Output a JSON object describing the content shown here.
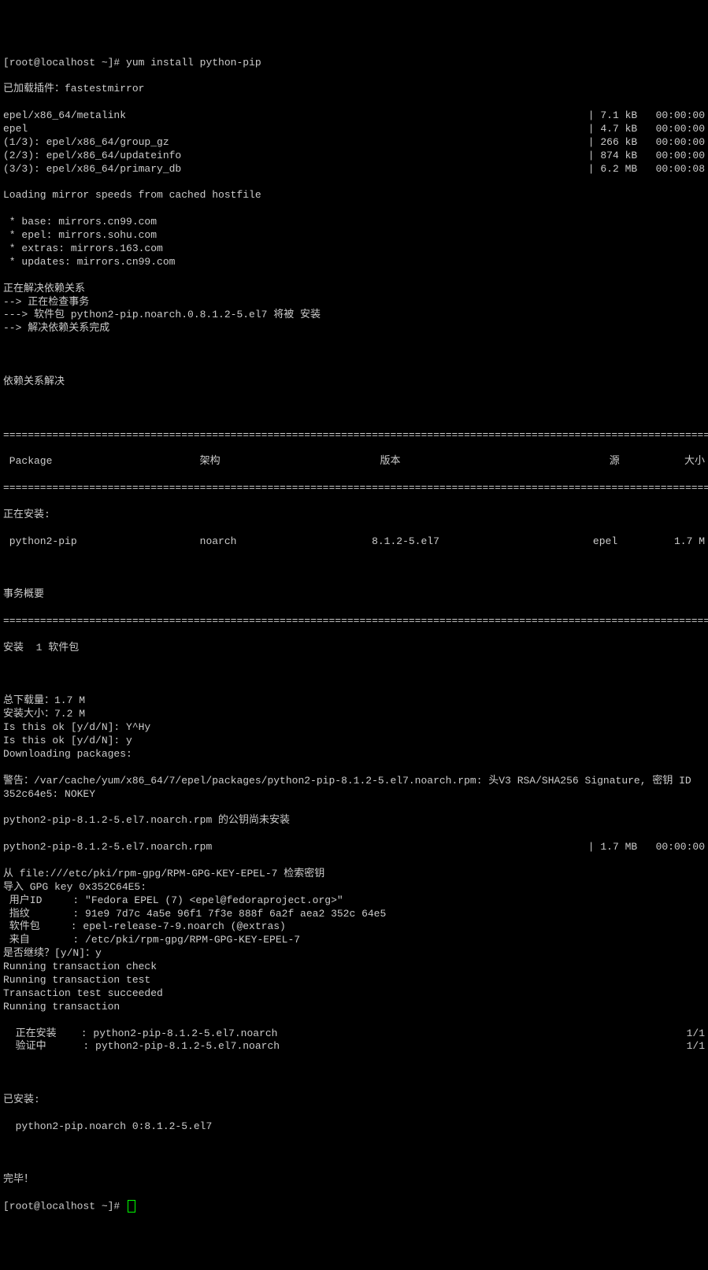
{
  "prompt1": "[root@localhost ~]# yum install python-pip",
  "plugin": "已加载插件：fastestmirror",
  "repos": [
    {
      "name": "epel/x86_64/metalink",
      "size": "7.1 kB",
      "time": "00:00:00"
    },
    {
      "name": "epel",
      "size": "4.7 kB",
      "time": "00:00:00"
    },
    {
      "name": "(1/3): epel/x86_64/group_gz",
      "size": "266 kB",
      "time": "00:00:00"
    },
    {
      "name": "(2/3): epel/x86_64/updateinfo",
      "size": "874 kB",
      "time": "00:00:00"
    },
    {
      "name": "(3/3): epel/x86_64/primary_db",
      "size": "6.2 MB",
      "time": "00:00:08"
    }
  ],
  "loading": "Loading mirror speeds from cached hostfile",
  "mirrors": [
    " * base: mirrors.cn99.com",
    " * epel: mirrors.sohu.com",
    " * extras: mirrors.163.com",
    " * updates: mirrors.cn99.com"
  ],
  "dep_lines": [
    "正在解决依赖关系",
    "--> 正在检查事务",
    "---> 软件包 python2-pip.noarch.0.8.1.2-5.el7 将被 安装",
    "--> 解决依赖关系完成"
  ],
  "dep_done": "依赖关系解决",
  "header": {
    "pkg": " Package",
    "arch": "架构",
    "ver": "版本",
    "repo": "源",
    "size": "大小"
  },
  "installing": "正在安装:",
  "row": {
    "pkg": " python2-pip",
    "arch": "noarch",
    "ver": "8.1.2-5.el7",
    "repo": "epel",
    "size": "1.7 M"
  },
  "summary": "事务概要",
  "install_count": "安装  1 软件包",
  "totals": [
    "总下载量：1.7 M",
    "安装大小：7.2 M",
    "Is this ok [y/d/N]: Y^Hy",
    "Is this ok [y/d/N]: y",
    "Downloading packages:"
  ],
  "warn": "警告：/var/cache/yum/x86_64/7/epel/packages/python2-pip-8.1.2-5.el7.noarch.rpm: 头V3 RSA/SHA256 Signature, 密钥 ID 352c64e5: NOKEY",
  "pubkey": "python2-pip-8.1.2-5.el7.noarch.rpm 的公钥尚未安装",
  "rpm_line": {
    "name": "python2-pip-8.1.2-5.el7.noarch.rpm",
    "size": "1.7 MB",
    "time": "00:00:00"
  },
  "gpg": [
    "从 file:///etc/pki/rpm-gpg/RPM-GPG-KEY-EPEL-7 检索密钥",
    "导入 GPG key 0x352C64E5:",
    " 用户ID     : \"Fedora EPEL (7) <epel@fedoraproject.org>\"",
    " 指纹       : 91e9 7d7c 4a5e 96f1 7f3e 888f 6a2f aea2 352c 64e5",
    " 软件包     : epel-release-7-9.noarch (@extras)",
    " 来自       : /etc/pki/rpm-gpg/RPM-GPG-KEY-EPEL-7",
    "是否继续？[y/N]：y",
    "Running transaction check",
    "Running transaction test",
    "Transaction test succeeded",
    "Running transaction"
  ],
  "trans": [
    {
      "label": "  正在安装    : python2-pip-8.1.2-5.el7.noarch",
      "count": "1/1"
    },
    {
      "label": "  验证中      : python2-pip-8.1.2-5.el7.noarch",
      "count": "1/1"
    }
  ],
  "installed_hdr": "已安装:",
  "installed_item": "  python2-pip.noarch 0:8.1.2-5.el7",
  "done": "完毕！",
  "prompt2": "[root@localhost ~]# "
}
